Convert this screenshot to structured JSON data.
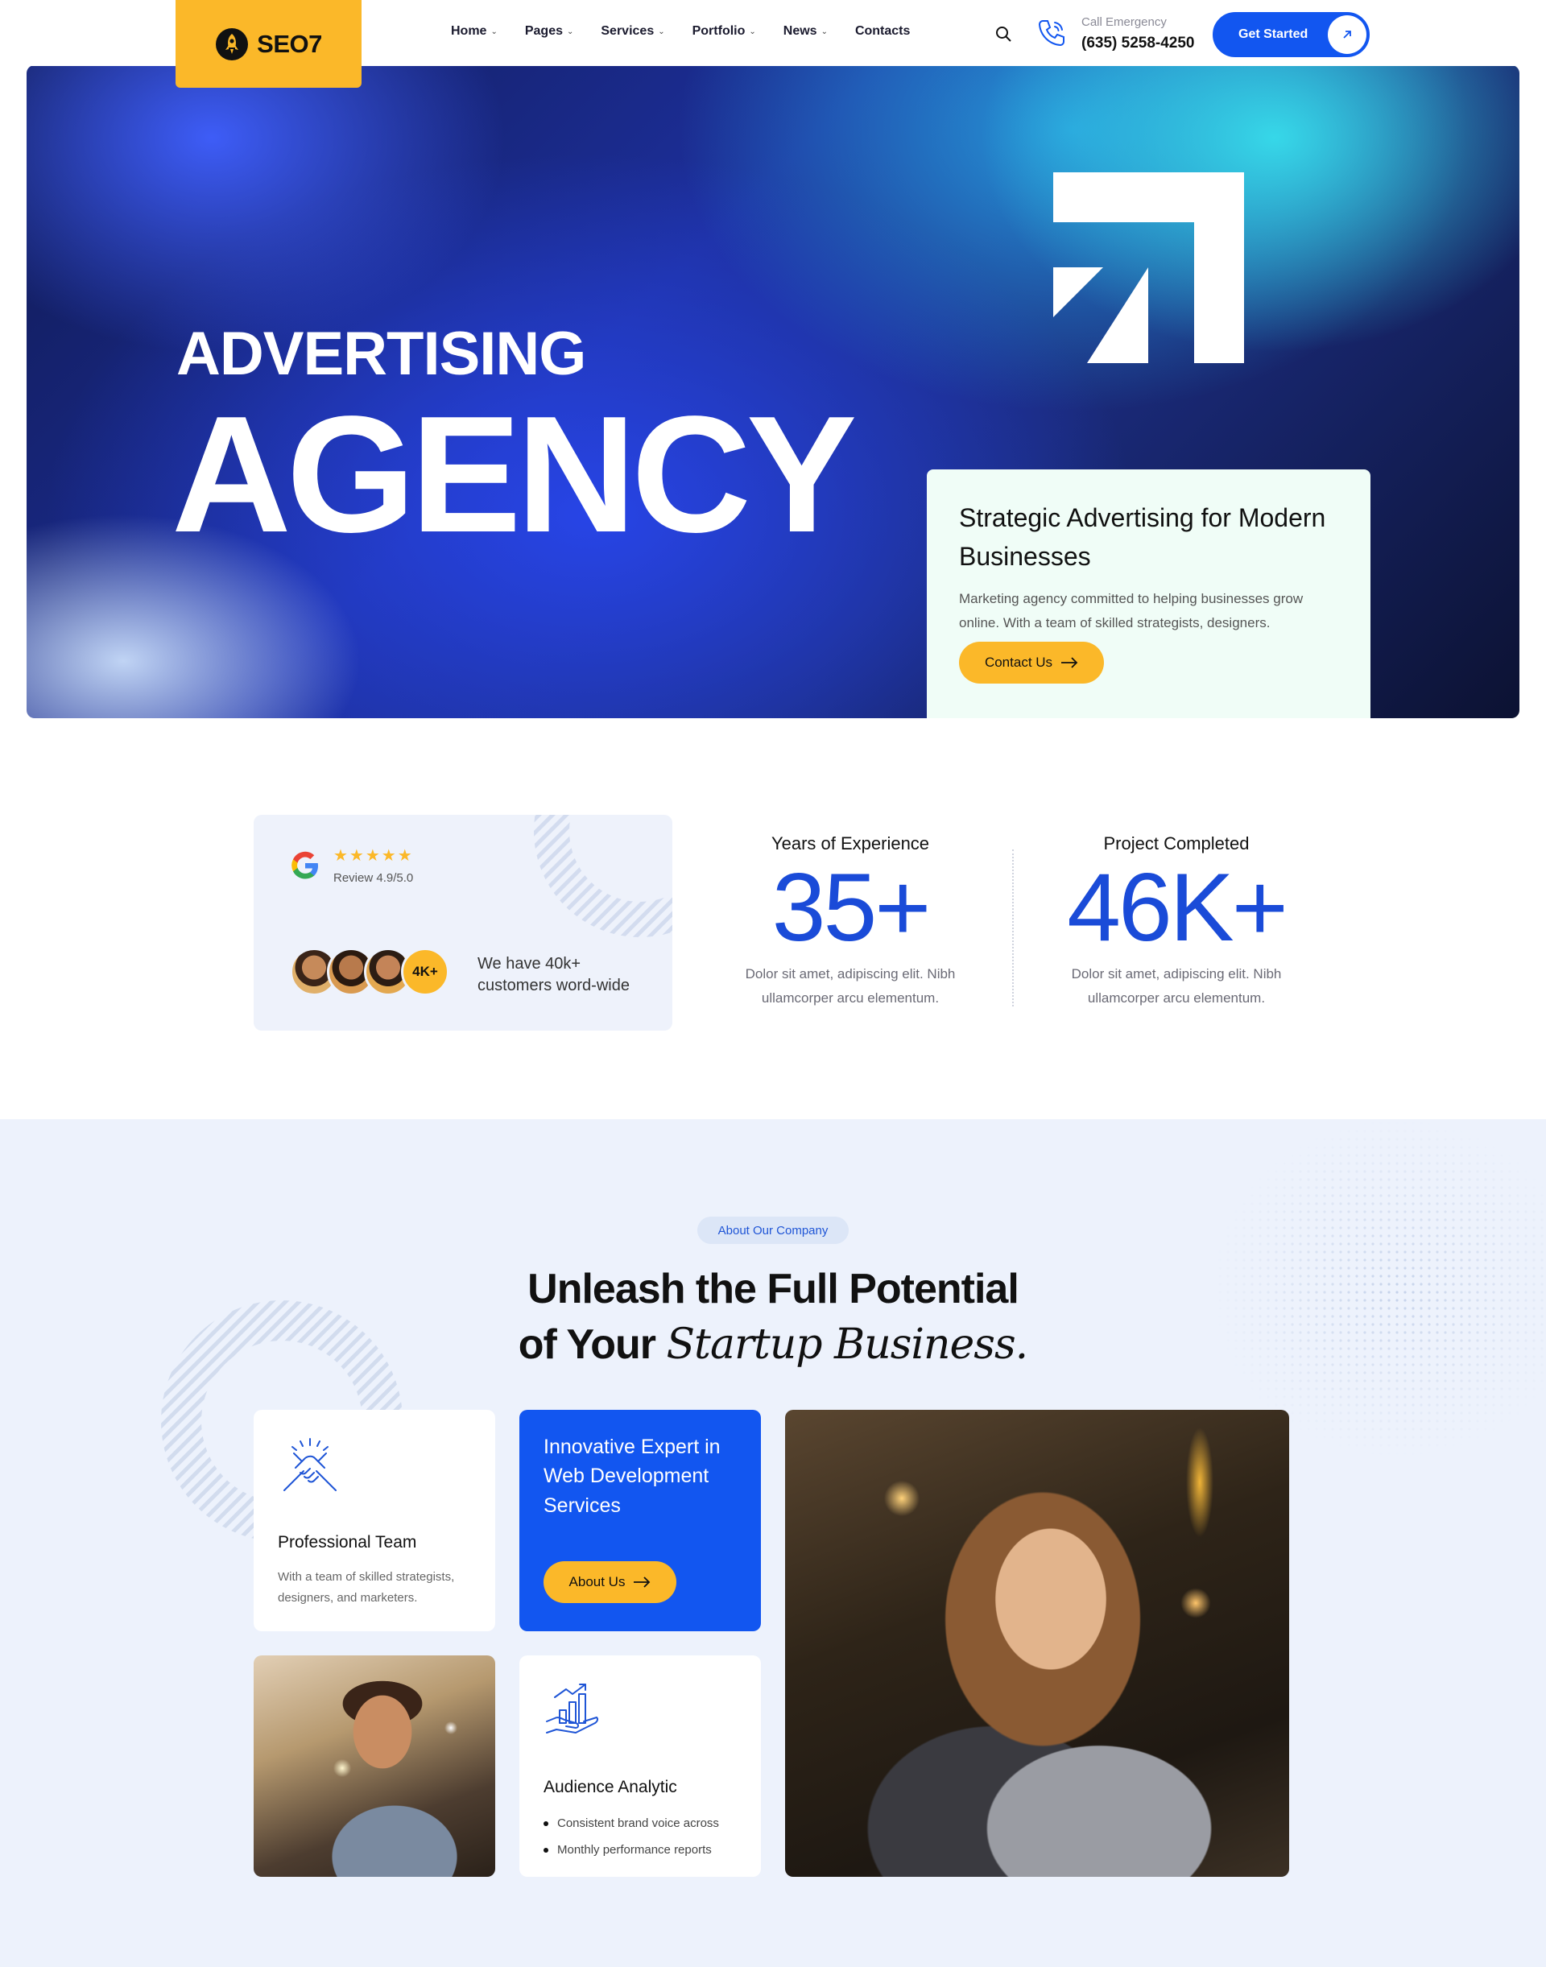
{
  "header": {
    "logo_text": "SEO7",
    "nav": [
      {
        "label": "Home",
        "has_dropdown": true
      },
      {
        "label": "Pages",
        "has_dropdown": true
      },
      {
        "label": "Services",
        "has_dropdown": true
      },
      {
        "label": "Portfolio",
        "has_dropdown": true
      },
      {
        "label": "News",
        "has_dropdown": true
      },
      {
        "label": "Contacts",
        "has_dropdown": false
      }
    ],
    "call_label": "Call Emergency",
    "call_number": "(635) 5258-4250",
    "cta_label": "Get Started"
  },
  "hero": {
    "title_line1": "ADVERTISING",
    "title_line2": "AGENCY",
    "card_title": "Strategic Advertising for Modern Businesses",
    "card_text": "Marketing agency committed to helping businesses grow online. With a team of skilled strategists, designers.",
    "button_label": "Contact Us"
  },
  "stats": {
    "review": {
      "stars": "★★★★★",
      "rating_text": "Review 4.9/5.0",
      "avatar_count": "4K+",
      "customers_text": "We have 40k+ customers word-wide"
    },
    "items": [
      {
        "title": "Years of Experience",
        "value": "35+",
        "desc": "Dolor sit amet, adipiscing elit. Nibh ullamcorper arcu elementum."
      },
      {
        "title": "Project Completed",
        "value": "46K+",
        "desc": "Dolor sit amet, adipiscing elit. Nibh ullamcorper arcu elementum."
      }
    ]
  },
  "about": {
    "badge": "About Our Company",
    "title_line1": "Unleash the Full Potential",
    "title_line2_plain": "of Your",
    "title_line2_italic": "Startup Business.",
    "team_card": {
      "title": "Professional Team",
      "text": "With a team of skilled strategists, designers, and marketers."
    },
    "blue_card": {
      "title": "Innovative Expert in Web Development Services",
      "button_label": "About Us"
    },
    "analytic_card": {
      "title": "Audience Analytic",
      "items": [
        "Consistent brand voice across",
        "Monthly performance reports"
      ]
    }
  },
  "colors": {
    "brand_yellow": "#fbb829",
    "brand_blue": "#1256f0",
    "stat_blue": "#1a4bd8",
    "section_bg": "#edf2fc",
    "hero_card_bg": "#f0fdf7"
  },
  "icons": [
    "rocket-icon",
    "chevron-down-icon",
    "search-icon",
    "phone-icon",
    "arrow-up-right-icon",
    "arrow-right-icon",
    "google-icon",
    "star-icon",
    "handshake-icon",
    "analytics-chart-icon"
  ]
}
